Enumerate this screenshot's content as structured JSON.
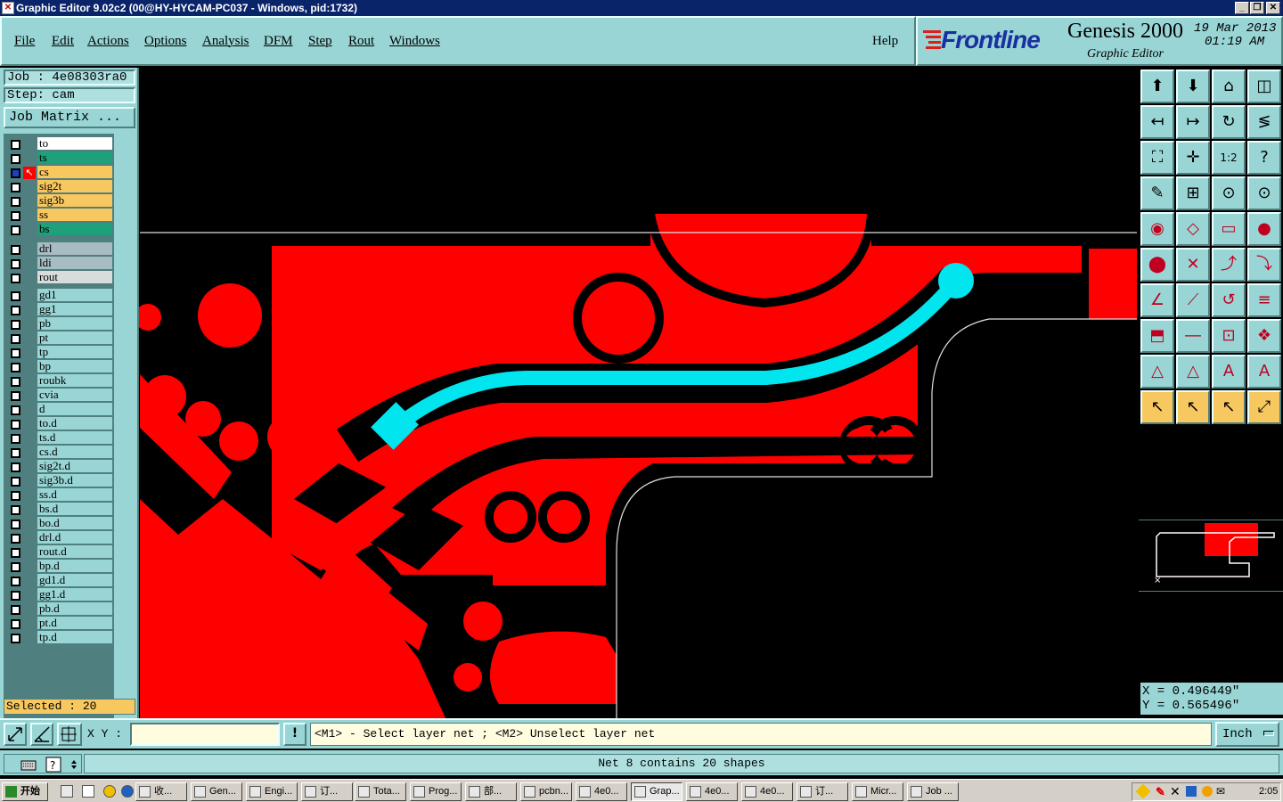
{
  "window": {
    "title": "Graphic Editor 9.02c2 (00@HY-HYCAM-PC037 - Windows, pid:1732)"
  },
  "menu": [
    "File",
    "Edit",
    "Actions",
    "Options",
    "Analysis",
    "DFM",
    "Step",
    "Rout",
    "Windows"
  ],
  "help_label": "Help",
  "logo": {
    "brand": "Frontline",
    "product": "Genesis 2000",
    "subtitle": "Graphic Editor",
    "date": "19 Mar 2013",
    "time": "01:19 AM"
  },
  "job": {
    "job_label": "Job : 4e08303ra0",
    "step_label": "Step: cam",
    "matrix_button": "Job Matrix ..."
  },
  "layers": {
    "signal": [
      {
        "name": "to",
        "color": "#ffffff"
      },
      {
        "name": "ts",
        "color": "#1ea07a"
      },
      {
        "name": "cs",
        "color": "#f8c860"
      },
      {
        "name": "sig2t",
        "color": "#f8c860"
      },
      {
        "name": "sig3b",
        "color": "#f8c860"
      },
      {
        "name": "ss",
        "color": "#f8c860"
      },
      {
        "name": "bs",
        "color": "#1ea07a"
      }
    ],
    "drill": [
      {
        "name": "drl",
        "color": "#a8bcc4"
      },
      {
        "name": "ldi",
        "color": "#a8bcc4"
      },
      {
        "name": "rout",
        "color": "#d8dcdc"
      }
    ],
    "misc": [
      "gd1",
      "gg1",
      "pb",
      "pt",
      "tp",
      "bp",
      "roubk",
      "cvia",
      "d",
      "to.d",
      "ts.d",
      "cs.d",
      "sig2t.d",
      "sig3b.d",
      "ss.d",
      "bs.d",
      "bo.d",
      "drl.d",
      "rout.d",
      "bp.d",
      "gd1.d",
      "gg1.d",
      "pb.d",
      "pt.d",
      "tp.d"
    ]
  },
  "selected_label": "Selected : 20",
  "coords": {
    "x": "X = 0.496449\"",
    "y": "Y = 0.565496\""
  },
  "command": {
    "xy_label": "X Y :",
    "xy_value": "",
    "prompt": "<M1> - Select layer net ; <M2> Unselect layer net",
    "units": "Inch"
  },
  "status": "Net 8 contains 20 shapes",
  "taskbar": {
    "start": "开始",
    "clock": "2:05",
    "tasks": [
      "收...",
      "Gen...",
      "Engi...",
      "订...",
      "Tota...",
      "Prog...",
      "部...",
      "pcbn...",
      "4e0...",
      "Grap...",
      "4e0...",
      "4e0...",
      "订...",
      "Micr...",
      "Job ..."
    ]
  },
  "colors": {
    "panel": "#99d5d5",
    "copper": "#ff0000",
    "selected_net": "#00e5ee",
    "canvas": "#000000"
  }
}
